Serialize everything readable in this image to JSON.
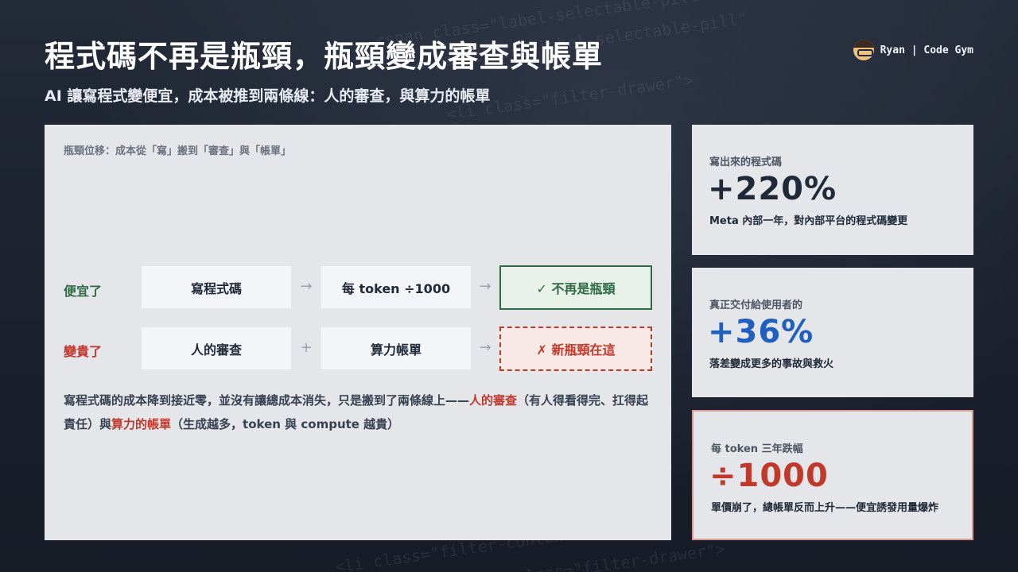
{
  "header": {
    "title": "程式碼不再是瓶頸，瓶頸變成審查與帳單",
    "subtitle": "AI 讓寫程式變便宜，成本被推到兩條線：人的審查，與算力的帳單",
    "brand": "Ryan | Code Gym"
  },
  "background_code": [
    "<span class=\"label-selectable-pill\"",
    "<span class=\"label-selectable-pill\"",
    "<li class=\"filter-drawer\">",
    "<li class=\"filter-content\"",
    "<li class=\"filter-drawer\">"
  ],
  "main": {
    "caption": "瓶頸位移：成本從「寫」搬到「審查」與「帳單」",
    "rows": [
      {
        "label": "便宜了",
        "label_color": "#2f6a45",
        "boxes": [
          "寫程式碼",
          "每 token ÷1000",
          "✓ 不再是瓶頸"
        ],
        "ops": [
          "→",
          "→"
        ]
      },
      {
        "label": "變貴了",
        "label_color": "#c0392b",
        "boxes": [
          "人的審查",
          "算力帳單",
          "✗ 新瓶頸在這"
        ],
        "ops": [
          "+",
          "→"
        ]
      }
    ],
    "note": {
      "part1": "寫程式碼的成本降到接近零，並沒有讓總成本消失，只是搬到了兩條線上——",
      "hl1": "人的審查",
      "part2": "（有人得看得完、扛得起責任）與",
      "hl2": "算力的帳單",
      "part3": "（生成越多，token 與 compute 越貴）"
    }
  },
  "stats": [
    {
      "label": "寫出來的程式碼",
      "value": "+220%",
      "value_color": "#1f2937",
      "desc": "Meta 內部一年，對內部平台的程式碼變更"
    },
    {
      "label": "真正交付給使用者的",
      "value": "+36%",
      "value_color": "#1f5fbf",
      "desc": "落差變成更多的事故與救火"
    },
    {
      "label": "每 token 三年跌幅",
      "value": "÷1000",
      "value_color": "#c0392b",
      "desc": "單價崩了，總帳單反而上升——便宜誘發用量爆炸"
    }
  ],
  "colors": {
    "good": "#2f6a45",
    "bad": "#c0392b",
    "blue": "#1f5fbf"
  }
}
